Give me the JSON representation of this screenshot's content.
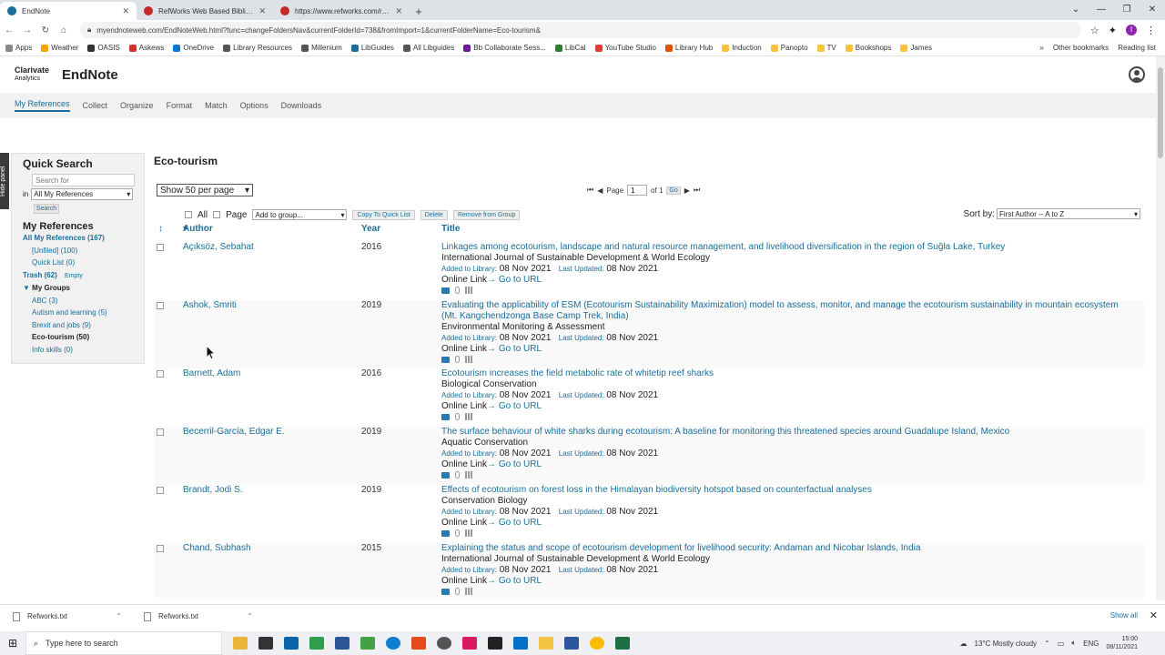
{
  "browser": {
    "tabs": [
      {
        "title": "EndNote",
        "color": "#1a6e99",
        "active": true
      },
      {
        "title": "RefWorks Web Based Bibliograp",
        "color": "#c62828",
        "active": false
      },
      {
        "title": "https://www.refworks.com/refw",
        "color": "#c62828",
        "active": false
      }
    ],
    "url": "myendnoteweb.com/EndNoteWeb.html?func=changeFoldersNav&currentFolderId=738&fromImport=1&currentFolderName=Eco-tourism&",
    "bookmarks": [
      "Apps",
      "Weather",
      "OASIS",
      "Askews",
      "OneDrive",
      "Library Resources",
      "Millenium",
      "LibGuides",
      "All Libguides",
      "Bb Collaborate Sess...",
      "LibCal",
      "YouTube Studio",
      "Library Hub",
      "Induction",
      "Panopto",
      "TV",
      "Bookshops",
      "James"
    ],
    "bookmarks_more": "»",
    "other_bookmarks": "Other bookmarks",
    "reading_list": "Reading list",
    "profile_initial": "I"
  },
  "header": {
    "logo_line1": "Clarivate",
    "logo_line2": "Analytics",
    "brand": "EndNote"
  },
  "nav": {
    "items": [
      "My References",
      "Collect",
      "Organize",
      "Format",
      "Match",
      "Options",
      "Downloads"
    ]
  },
  "hide_panel": "Hide panel",
  "sidebar": {
    "quick_search": "Quick Search",
    "search_placeholder": "Search for",
    "in_label": "in",
    "scope": "All My References",
    "search_btn": "Search",
    "my_refs": "My References",
    "all_refs": "All My References (167)",
    "unfiled": "[Unfiled] (100)",
    "quick_list": "Quick List (0)",
    "trash": "Trash (62)",
    "empty": "Empty",
    "my_groups": "My Groups",
    "groups": [
      "ABC  (3)",
      "Autism and learning  (5)",
      "Brexit and jobs  (9)",
      "Eco-tourism  (50)",
      "Info skills  (0)"
    ]
  },
  "content": {
    "folder_title": "Eco-tourism",
    "per_page": "Show 50 per page",
    "page_label": "Page",
    "page_value": "1",
    "of_label": "of 1",
    "go": "Go",
    "all": "All",
    "page": "Page",
    "add_to_group": "Add to group...",
    "copy_quick": "Copy To Quick List",
    "delete": "Delete",
    "remove_group": "Remove from Group",
    "sort_by": "Sort by:",
    "sort_value": "First Author -- A to Z",
    "col_author": "Author",
    "col_year": "Year",
    "col_title": "Title",
    "added_label": "Added to Library:",
    "updated_label": "Last Updated:",
    "online_link": "Online Link",
    "go_url": "Go to URL",
    "refs": [
      {
        "author": "Açıksöz, Sebahat",
        "year": "2016",
        "title": "Linkages among ecotourism, landscape and natural resource management, and livelihood diversification in the region of Suğla Lake, Turkey",
        "journal": "International Journal of Sustainable Development & World Ecology",
        "added": "08 Nov 2021",
        "updated": "08 Nov 2021"
      },
      {
        "author": "Ashok, Smriti",
        "year": "2019",
        "title": "Evaluating the applicability of ESM (Ecotourism Sustainability Maximization) model to assess, monitor, and manage the ecotourism sustainability in mountain ecosystem (Mt. Kangchendzonga Base Camp Trek, India)",
        "journal": "Environmental Monitoring & Assessment",
        "added": "08 Nov 2021",
        "updated": "08 Nov 2021"
      },
      {
        "author": "Barnett, Adam",
        "year": "2016",
        "title": "Ecotourism increases the field metabolic rate of whitetip reef sharks",
        "journal": "Biological Conservation",
        "added": "08 Nov 2021",
        "updated": "08 Nov 2021"
      },
      {
        "author": "Becerril-García, Edgar E.",
        "year": "2019",
        "title": "The surface behaviour of white sharks during ecotourism: A baseline for monitoring this threatened species around Guadalupe Island, Mexico",
        "journal": "Aquatic Conservation",
        "added": "08 Nov 2021",
        "updated": "08 Nov 2021"
      },
      {
        "author": "Brandt, Jodi S.",
        "year": "2019",
        "title": "Effects of ecotourism on forest loss in the Himalayan biodiversity hotspot based on counterfactual analyses",
        "journal": "Conservation Biology",
        "added": "08 Nov 2021",
        "updated": "08 Nov 2021"
      },
      {
        "author": "Chand, Subhash",
        "year": "2015",
        "title": "Explaining the status and scope of ecotourism development for livelihood security: Andaman and Nicobar Islands, India",
        "journal": "International Journal of Sustainable Development & World Ecology",
        "added": "08 Nov 2021",
        "updated": "08 Nov 2021"
      }
    ]
  },
  "downloads": {
    "items": [
      "Refworks.txt",
      "Refworks.txt"
    ],
    "show_all": "Show all"
  },
  "taskbar": {
    "search": "Type here to search",
    "weather": "13°C  Mostly cloudy",
    "lang": "ENG",
    "time": "15:00",
    "date": "08/11/2021"
  }
}
